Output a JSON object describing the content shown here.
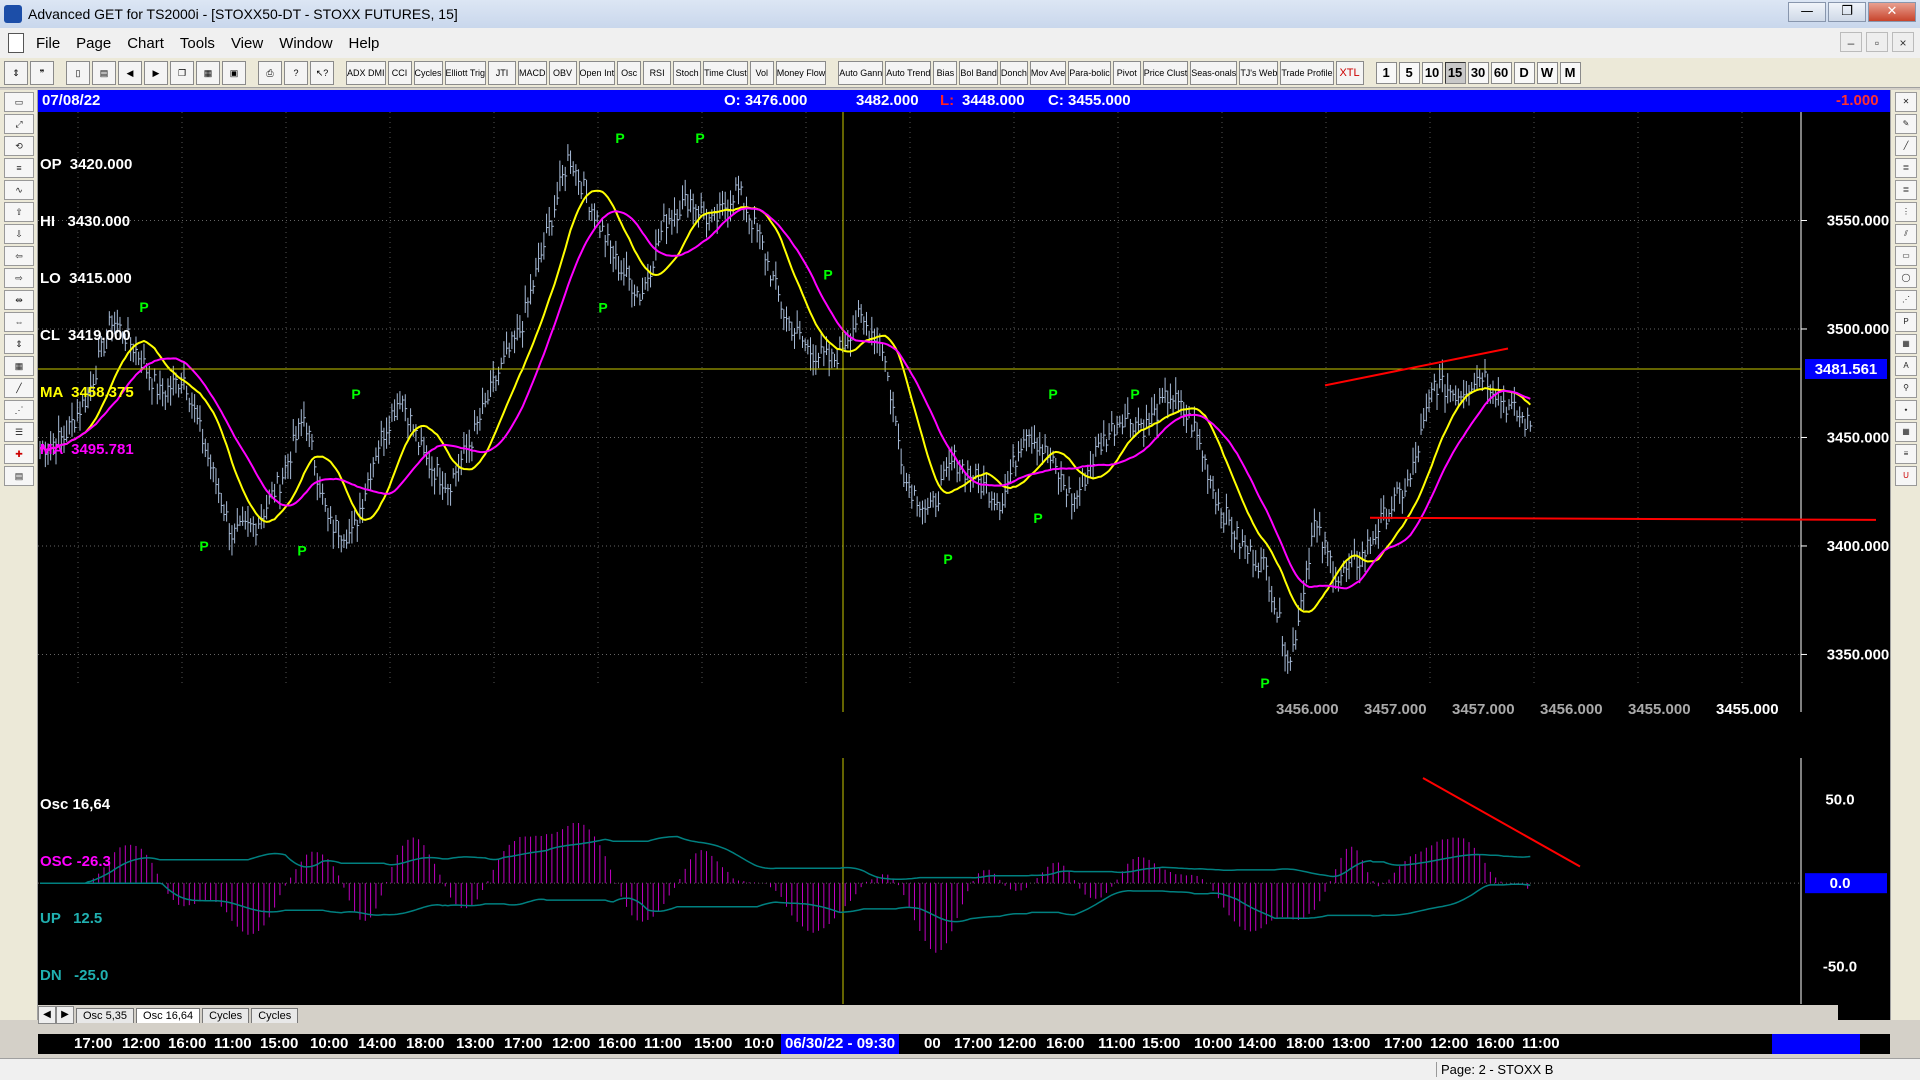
{
  "window": {
    "title": "Advanced GET for TS2000i - [STOXX50-DT - STOXX FUTURES, 15]",
    "controls": [
      "—",
      "❐",
      "✕"
    ]
  },
  "menu": {
    "items": [
      "File",
      "Page",
      "Chart",
      "Tools",
      "View",
      "Window",
      "Help"
    ],
    "mdi_controls": [
      "–",
      "▫",
      "×"
    ]
  },
  "toolbar": {
    "studies": [
      "ADX DMI",
      "CCI",
      "Cycles",
      "Elliott Trig",
      "JTI",
      "MACD",
      "OBV",
      "Open Int",
      "Osc",
      "RSI",
      "Stoch",
      "Time Clust",
      "Vol",
      "Money Flow",
      "Auto Gann",
      "Auto Trend",
      "Bias",
      "Bol Band",
      "Donch",
      "Mov Ave",
      "Para-bolic",
      "Pivot",
      "Price Clust",
      "Seas-onals",
      "TJ's Web",
      "Trade Profile",
      "XTL"
    ],
    "periods": [
      "1",
      "5",
      "10",
      "15",
      "30",
      "60",
      "D",
      "W",
      "M"
    ],
    "active_period": "15"
  },
  "header": {
    "date": "07/08/22",
    "open": "O: 3476.000",
    "high": "3482.000",
    "low_label": "L:",
    "low": "3448.000",
    "close": "C: 3455.000",
    "change": "-1.000"
  },
  "legend": {
    "op": "OP  3420.000",
    "hi": "HI   3430.000",
    "lo": "LO  3415.000",
    "cl": "CL  3419.000",
    "ma1": "MA  3458.375",
    "ma2": "MA  3495.781"
  },
  "price_axis": {
    "labels": [
      "3550.000",
      "3500.000",
      "3450.000",
      "3400.000",
      "3350.000"
    ],
    "current": "3481.561"
  },
  "bottom_values": [
    "3456.000",
    "3457.000",
    "3457.000",
    "3456.000",
    "3455.000",
    "3455.000"
  ],
  "osc_legend": {
    "title": "Osc 16,64",
    "osc": "OSC -26.3",
    "up": "UP   12.5",
    "dn": "DN   -25.0"
  },
  "osc_axis": {
    "labels": [
      "50.0",
      "0.0",
      "-50.0"
    ]
  },
  "tabs": {
    "items": [
      "Osc 5,35",
      "Osc 16,64",
      "Cycles",
      "Cycles"
    ],
    "active": "Osc 16,64"
  },
  "time_axis": {
    "labels": [
      "17:00",
      "12:00",
      "16:00",
      "11:00",
      "15:00",
      "10:00",
      "14:00",
      "18:00",
      "13:00",
      "17:00",
      "12:00",
      "16:00",
      "11:00",
      "15:00",
      "10:0",
      "00",
      "17:00",
      "12:00",
      "16:00",
      "11:00",
      "15:00",
      "10:00",
      "14:00",
      "18:00",
      "13:00",
      "17:00",
      "12:00",
      "16:00",
      "11:00"
    ],
    "cursor": "06/30/22 - 09:30"
  },
  "status": {
    "page": "Page: 2 - STOXX B"
  },
  "colors": {
    "price_bars": "#a8bcd8",
    "ma_fast": "#ffff00",
    "ma_slow": "#ff00ff",
    "pivot": "#00ff00",
    "trendline": "#ff0000",
    "osc": "#c000c0",
    "band": "#008080",
    "header": "#0000ff"
  },
  "chart_data": {
    "type": "line",
    "title": "STOXX50-DT - STOXX FUTURES, 15",
    "interval": "15 min",
    "y_range": [
      3335,
      3600
    ],
    "price_path": [
      3445,
      3450,
      3470,
      3505,
      3490,
      3470,
      3478,
      3440,
      3405,
      3410,
      3430,
      3460,
      3410,
      3405,
      3445,
      3470,
      3440,
      3428,
      3450,
      3478,
      3500,
      3540,
      3580,
      3555,
      3530,
      3515,
      3550,
      3560,
      3548,
      3565,
      3540,
      3505,
      3490,
      3485,
      3505,
      3495,
      3430,
      3415,
      3440,
      3430,
      3420,
      3455,
      3440,
      3420,
      3445,
      3460,
      3455,
      3470,
      3455,
      3420,
      3400,
      3390,
      3345,
      3410,
      3385,
      3395,
      3415,
      3430,
      3475,
      3470,
      3480,
      3465,
      3455
    ],
    "pivot_highs": [
      3505,
      3465,
      3583,
      3565,
      3520,
      3465,
      3465
    ],
    "pivot_lows": [
      3405,
      3403,
      3515,
      3399,
      3418,
      3342
    ],
    "ma_fast_value": 3458.375,
    "ma_slow_value": 3495.781,
    "horizontal_level": 3481.561,
    "oscillator": {
      "name": "Osc 16,64",
      "osc": -26.3,
      "up": 12.5,
      "dn": -25.0,
      "y_range": [
        -70,
        75
      ]
    }
  }
}
